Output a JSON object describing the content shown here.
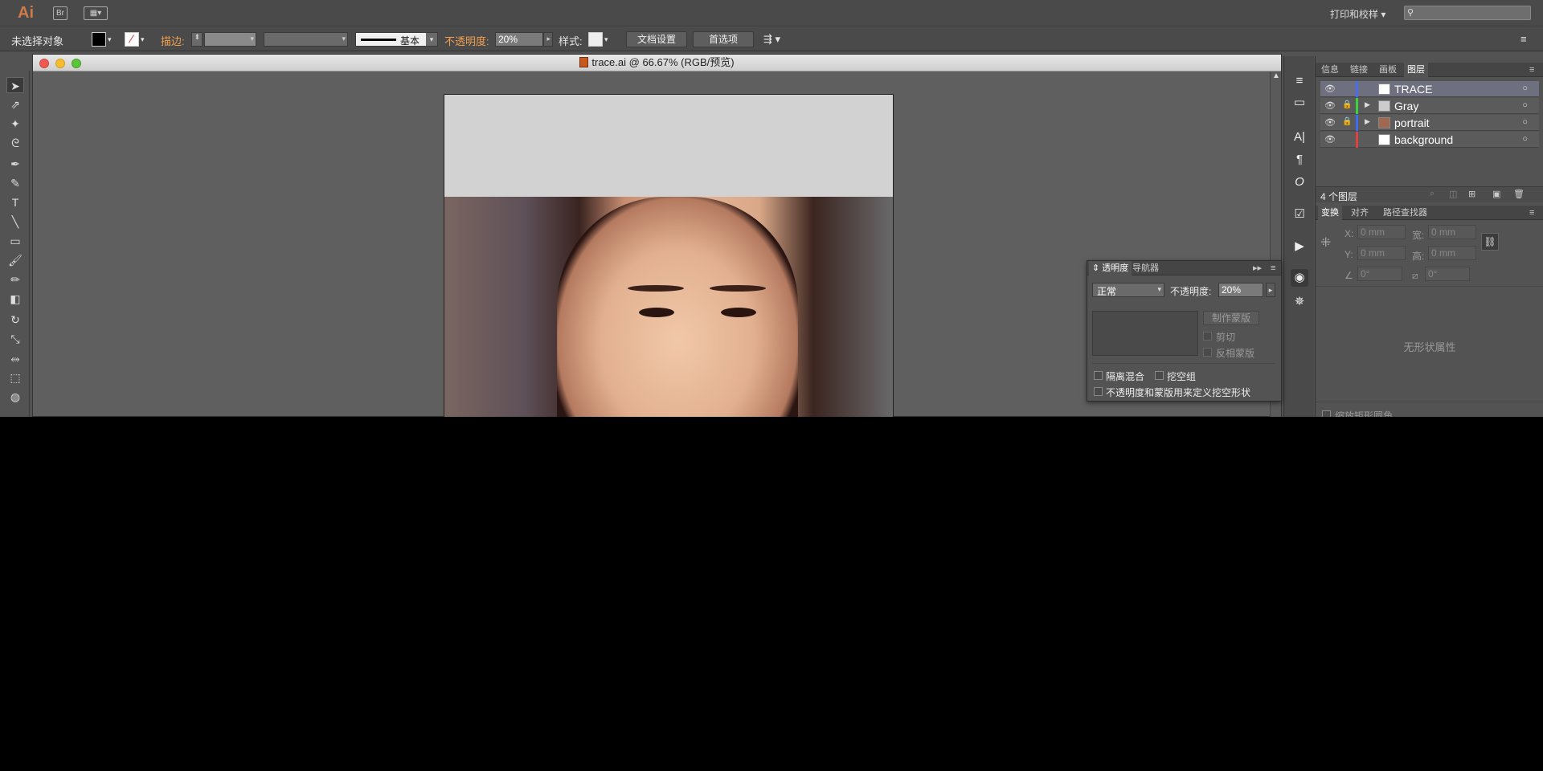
{
  "menubar": {
    "app_logo": "Ai",
    "bridge_label": "Br",
    "print_menu": "打印和校样",
    "search_icon": "search-icon"
  },
  "control": {
    "selection_status": "未选择对象",
    "stroke_label": "描边:",
    "stroke_profile": "基本",
    "opacity_label": "不透明度:",
    "opacity_value": "20%",
    "style_label": "样式:",
    "doc_setup_button": "文档设置",
    "preferences_button": "首选项"
  },
  "document": {
    "title": "trace.ai @ 66.67% (RGB/预览)"
  },
  "layers_panel": {
    "tabs": [
      "信息",
      "链接",
      "画板",
      "图层"
    ],
    "layers": [
      {
        "name": "TRACE",
        "color": "#4a6cf0"
      },
      {
        "name": "Gray",
        "color": "#3cd23c"
      },
      {
        "name": "portrait",
        "color": "#3c6cf0"
      },
      {
        "name": "background",
        "color": "#e04040"
      }
    ],
    "count_label": "4 个图层"
  },
  "transform_panel": {
    "tabs": [
      "变换",
      "对齐",
      "路径查找器"
    ],
    "x_label": "X:",
    "y_label": "Y:",
    "w_label": "宽:",
    "h_label": "高:",
    "x_value": "0 mm",
    "y_value": "0 mm",
    "w_value": "0 mm",
    "h_value": "0 mm",
    "angle_value": "0°",
    "shear_value": "0°",
    "empty_message": "无形状属性",
    "scale_corners": "缩放矩形圆角"
  },
  "transparency_panel": {
    "tabs": [
      "透明度",
      "导航器"
    ],
    "blend_mode": "正常",
    "opacity_label": "不透明度:",
    "opacity_value": "20%",
    "make_mask_button": "制作蒙版",
    "clip_label": "剪切",
    "invert_label": "反相蒙版",
    "isolate_label": "隔离混合",
    "knockout_label": "挖空组",
    "opacity_mask_label": "不透明度和蒙版用来定义挖空形状"
  }
}
